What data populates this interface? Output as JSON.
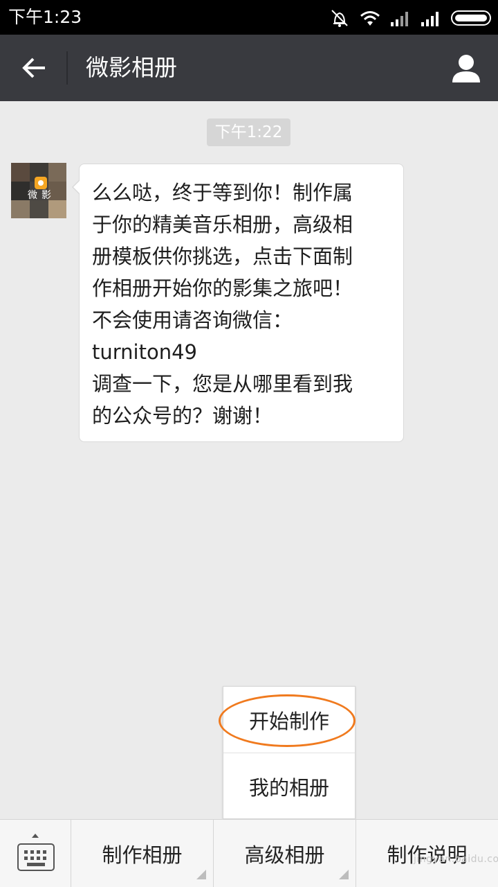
{
  "status_bar": {
    "time": "下午1:23",
    "icons": [
      "mute-alarm-icon",
      "wifi-icon",
      "signal-icon",
      "signal-icon-2",
      "battery-icon"
    ]
  },
  "title_bar": {
    "title": "微影相册",
    "back_icon": "back-arrow-icon",
    "profile_icon": "person-icon"
  },
  "chat": {
    "timestamp": "下午1:22",
    "avatar_text": "微影",
    "message_lines": [
      "么么哒，终于等到你！制作属",
      "于你的精美音乐相册，高级相",
      "册模板供你挑选，点击下面制",
      "作相册开始你的影集之旅吧！",
      "不会使用请咨询微信：",
      "turniton49",
      "调查一下，您是从哪里看到我",
      "的公众号的？谢谢！"
    ]
  },
  "popup_menu": {
    "items": [
      "开始制作",
      "我的相册"
    ],
    "highlight_color": "#f07a1e"
  },
  "bottom_menu": {
    "keyboard_icon": "keyboard-icon",
    "tabs": [
      "制作相册",
      "高级相册",
      "制作说明"
    ]
  },
  "watermark": "jingyan.baidu.com"
}
